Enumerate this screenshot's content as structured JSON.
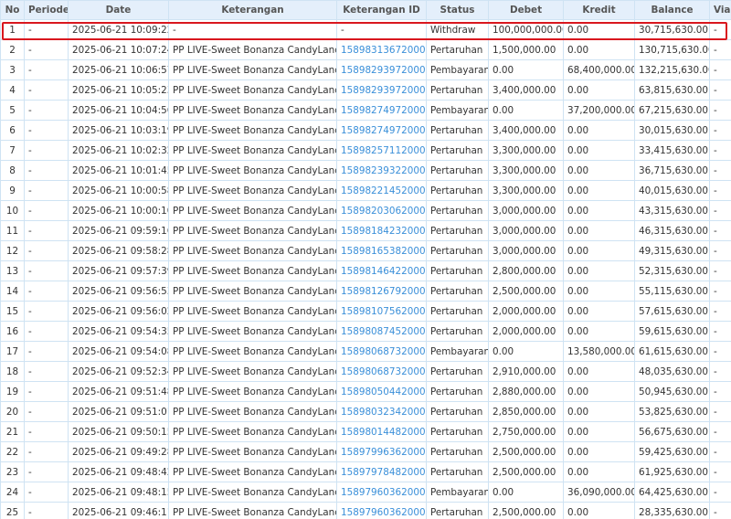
{
  "headers": [
    "No",
    "Periode",
    "Date",
    "Keterangan",
    "Keterangan ID",
    "Status",
    "Debet",
    "Kredit",
    "Balance",
    "Via"
  ],
  "rows": [
    {
      "no": "1",
      "periode": "-",
      "date": "2025-06-21 10:09:22",
      "ket": "-",
      "ket_id": "-",
      "status": "Withdraw",
      "debet": "100,000,000.00",
      "kredit": "0.00",
      "balance": "30,715,630.00",
      "via": "-"
    },
    {
      "no": "2",
      "periode": "-",
      "date": "2025-06-21 10:07:24",
      "ket": "PP LIVE-Sweet Bonanza CandyLand",
      "ket_id": "158983136720008",
      "status": "Pertaruhan",
      "debet": "1,500,000.00",
      "kredit": "0.00",
      "balance": "130,715,630.00",
      "via": "-"
    },
    {
      "no": "3",
      "periode": "-",
      "date": "2025-06-21 10:06:57",
      "ket": "PP LIVE-Sweet Bonanza CandyLand",
      "ket_id": "158982939720008",
      "status": "Pembayaran",
      "debet": "0.00",
      "kredit": "68,400,000.00",
      "balance": "132,215,630.00",
      "via": "-"
    },
    {
      "no": "4",
      "periode": "-",
      "date": "2025-06-21 10:05:23",
      "ket": "PP LIVE-Sweet Bonanza CandyLand",
      "ket_id": "158982939720008",
      "status": "Pertaruhan",
      "debet": "3,400,000.00",
      "kredit": "0.00",
      "balance": "63,815,630.00",
      "via": "-"
    },
    {
      "no": "5",
      "periode": "-",
      "date": "2025-06-21 10:04:56",
      "ket": "PP LIVE-Sweet Bonanza CandyLand",
      "ket_id": "158982749720008",
      "status": "Pembayaran",
      "debet": "0.00",
      "kredit": "37,200,000.00",
      "balance": "67,215,630.00",
      "via": "-"
    },
    {
      "no": "6",
      "periode": "-",
      "date": "2025-06-21 10:03:19",
      "ket": "PP LIVE-Sweet Bonanza CandyLand",
      "ket_id": "158982749720008",
      "status": "Pertaruhan",
      "debet": "3,400,000.00",
      "kredit": "0.00",
      "balance": "30,015,630.00",
      "via": "-"
    },
    {
      "no": "7",
      "periode": "-",
      "date": "2025-06-21 10:02:32",
      "ket": "PP LIVE-Sweet Bonanza CandyLand",
      "ket_id": "158982571120008",
      "status": "Pertaruhan",
      "debet": "3,300,000.00",
      "kredit": "0.00",
      "balance": "33,415,630.00",
      "via": "-"
    },
    {
      "no": "8",
      "periode": "-",
      "date": "2025-06-21 10:01:45",
      "ket": "PP LIVE-Sweet Bonanza CandyLand",
      "ket_id": "158982393220008",
      "status": "Pertaruhan",
      "debet": "3,300,000.00",
      "kredit": "0.00",
      "balance": "36,715,630.00",
      "via": "-"
    },
    {
      "no": "9",
      "periode": "-",
      "date": "2025-06-21 10:00:58",
      "ket": "PP LIVE-Sweet Bonanza CandyLand",
      "ket_id": "158982214520008",
      "status": "Pertaruhan",
      "debet": "3,300,000.00",
      "kredit": "0.00",
      "balance": "40,015,630.00",
      "via": "-"
    },
    {
      "no": "10",
      "periode": "-",
      "date": "2025-06-21 10:00:10",
      "ket": "PP LIVE-Sweet Bonanza CandyLand",
      "ket_id": "158982030620008",
      "status": "Pertaruhan",
      "debet": "3,000,000.00",
      "kredit": "0.00",
      "balance": "43,315,630.00",
      "via": "-"
    },
    {
      "no": "11",
      "periode": "-",
      "date": "2025-06-21 09:59:16",
      "ket": "PP LIVE-Sweet Bonanza CandyLand",
      "ket_id": "158981842320008",
      "status": "Pertaruhan",
      "debet": "3,000,000.00",
      "kredit": "0.00",
      "balance": "46,315,630.00",
      "via": "-"
    },
    {
      "no": "12",
      "periode": "-",
      "date": "2025-06-21 09:58:28",
      "ket": "PP LIVE-Sweet Bonanza CandyLand",
      "ket_id": "158981653820008",
      "status": "Pertaruhan",
      "debet": "3,000,000.00",
      "kredit": "0.00",
      "balance": "49,315,630.00",
      "via": "-"
    },
    {
      "no": "13",
      "periode": "-",
      "date": "2025-06-21 09:57:39",
      "ket": "PP LIVE-Sweet Bonanza CandyLand",
      "ket_id": "158981464220008",
      "status": "Pertaruhan",
      "debet": "2,800,000.00",
      "kredit": "0.00",
      "balance": "52,315,630.00",
      "via": "-"
    },
    {
      "no": "14",
      "periode": "-",
      "date": "2025-06-21 09:56:53",
      "ket": "PP LIVE-Sweet Bonanza CandyLand",
      "ket_id": "158981267920008",
      "status": "Pertaruhan",
      "debet": "2,500,000.00",
      "kredit": "0.00",
      "balance": "55,115,630.00",
      "via": "-"
    },
    {
      "no": "15",
      "periode": "-",
      "date": "2025-06-21 09:56:02",
      "ket": "PP LIVE-Sweet Bonanza CandyLand",
      "ket_id": "158981075620008",
      "status": "Pertaruhan",
      "debet": "2,000,000.00",
      "kredit": "0.00",
      "balance": "57,615,630.00",
      "via": "-"
    },
    {
      "no": "16",
      "periode": "-",
      "date": "2025-06-21 09:54:35",
      "ket": "PP LIVE-Sweet Bonanza CandyLand",
      "ket_id": "158980874520008",
      "status": "Pertaruhan",
      "debet": "2,000,000.00",
      "kredit": "0.00",
      "balance": "59,615,630.00",
      "via": "-"
    },
    {
      "no": "17",
      "periode": "-",
      "date": "2025-06-21 09:54:08",
      "ket": "PP LIVE-Sweet Bonanza CandyLand",
      "ket_id": "158980687320008",
      "status": "Pembayaran",
      "debet": "0.00",
      "kredit": "13,580,000.00",
      "balance": "61,615,630.00",
      "via": "-"
    },
    {
      "no": "18",
      "periode": "-",
      "date": "2025-06-21 09:52:34",
      "ket": "PP LIVE-Sweet Bonanza CandyLand",
      "ket_id": "158980687320008",
      "status": "Pertaruhan",
      "debet": "2,910,000.00",
      "kredit": "0.00",
      "balance": "48,035,630.00",
      "via": "-"
    },
    {
      "no": "19",
      "periode": "-",
      "date": "2025-06-21 09:51:48",
      "ket": "PP LIVE-Sweet Bonanza CandyLand",
      "ket_id": "158980504420008",
      "status": "Pertaruhan",
      "debet": "2,880,000.00",
      "kredit": "0.00",
      "balance": "50,945,630.00",
      "via": "-"
    },
    {
      "no": "20",
      "periode": "-",
      "date": "2025-06-21 09:51:01",
      "ket": "PP LIVE-Sweet Bonanza CandyLand",
      "ket_id": "158980323420008",
      "status": "Pertaruhan",
      "debet": "2,850,000.00",
      "kredit": "0.00",
      "balance": "53,825,630.00",
      "via": "-"
    },
    {
      "no": "21",
      "periode": "-",
      "date": "2025-06-21 09:50:15",
      "ket": "PP LIVE-Sweet Bonanza CandyLand",
      "ket_id": "158980144820008",
      "status": "Pertaruhan",
      "debet": "2,750,000.00",
      "kredit": "0.00",
      "balance": "56,675,630.00",
      "via": "-"
    },
    {
      "no": "22",
      "periode": "-",
      "date": "2025-06-21 09:49:28",
      "ket": "PP LIVE-Sweet Bonanza CandyLand",
      "ket_id": "158979963620008",
      "status": "Pertaruhan",
      "debet": "2,500,000.00",
      "kredit": "0.00",
      "balance": "59,425,630.00",
      "via": "-"
    },
    {
      "no": "23",
      "periode": "-",
      "date": "2025-06-21 09:48:42",
      "ket": "PP LIVE-Sweet Bonanza CandyLand",
      "ket_id": "158979784820008",
      "status": "Pertaruhan",
      "debet": "2,500,000.00",
      "kredit": "0.00",
      "balance": "61,925,630.00",
      "via": "-"
    },
    {
      "no": "24",
      "periode": "-",
      "date": "2025-06-21 09:48:15",
      "ket": "PP LIVE-Sweet Bonanza CandyLand",
      "ket_id": "158979603620008",
      "status": "Pembayaran",
      "debet": "0.00",
      "kredit": "36,090,000.00",
      "balance": "64,425,630.00",
      "via": "-"
    },
    {
      "no": "25",
      "periode": "-",
      "date": "2025-06-21 09:46:11",
      "ket": "PP LIVE-Sweet Bonanza CandyLand",
      "ket_id": "158979603620008",
      "status": "Pertaruhan",
      "debet": "2,500,000.00",
      "kredit": "0.00",
      "balance": "28,335,630.00",
      "via": "-"
    }
  ],
  "colors": {
    "link": "#3a8fd9",
    "highlight_border": "#d9171e",
    "withdraw_amount": "#e00000",
    "header_bg": "#e4effb"
  }
}
